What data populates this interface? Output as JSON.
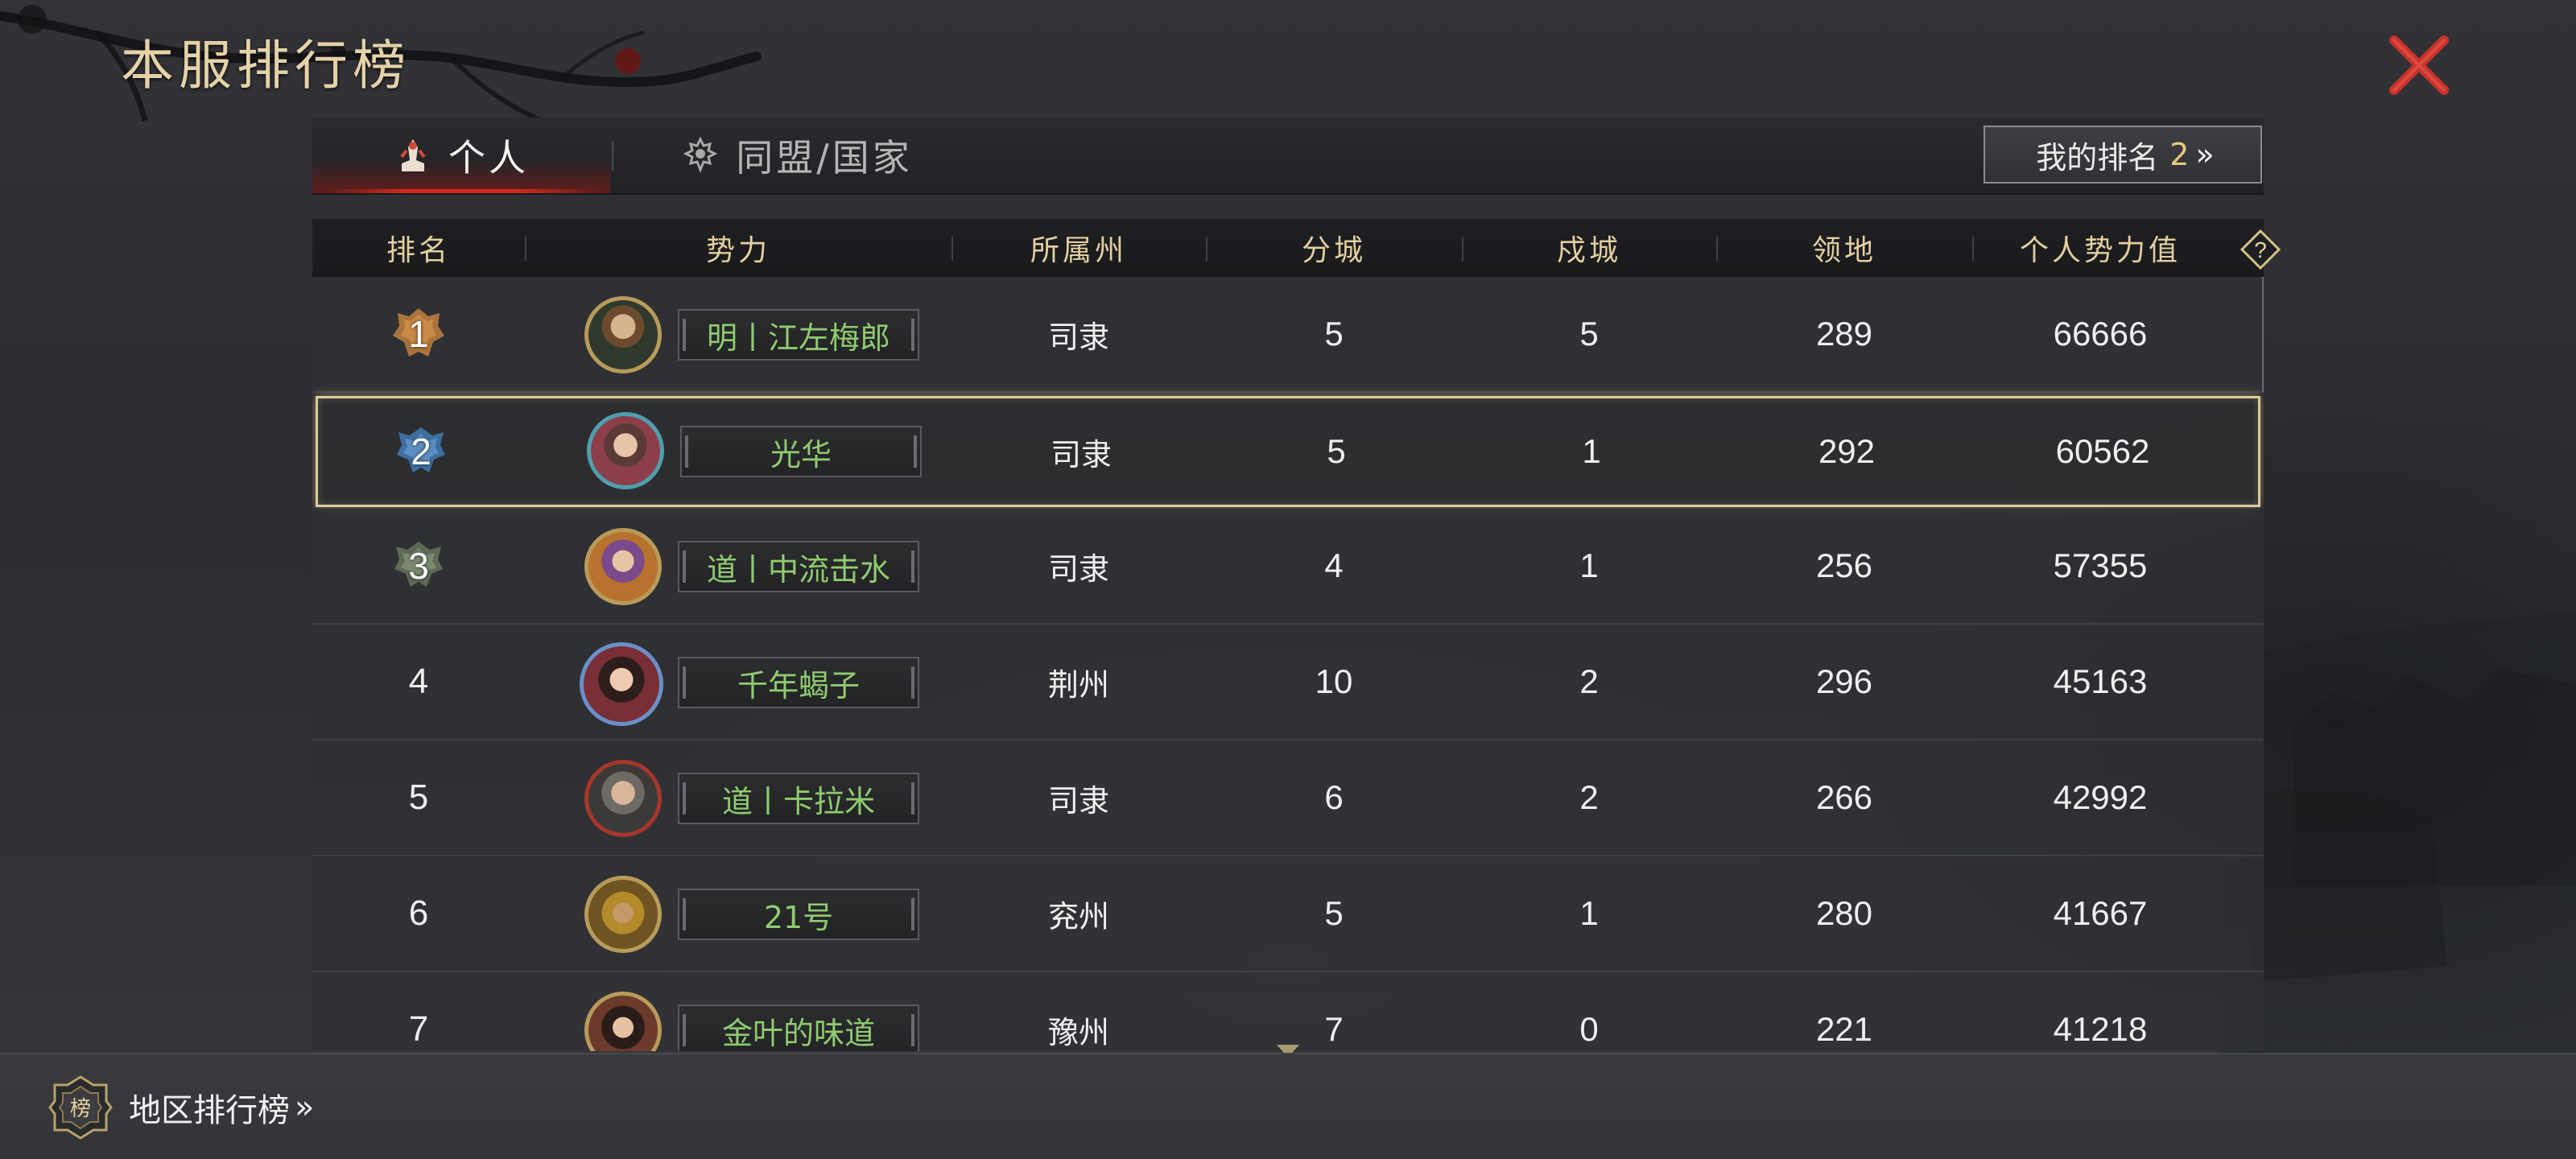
{
  "title": "本服排行榜",
  "tabs": [
    {
      "label": "个人",
      "icon": "personal-icon",
      "active": true
    },
    {
      "label": "同盟/国家",
      "icon": "alliance-icon",
      "active": false
    }
  ],
  "my_rank": {
    "label": "我的排名",
    "value": "2",
    "chevron": "»"
  },
  "columns": [
    "排名",
    "势力",
    "所属州",
    "分城",
    "戍城",
    "领地",
    "个人势力值"
  ],
  "help": {
    "label": "?"
  },
  "rows": [
    {
      "rank": "1",
      "name": "明丨江左梅郎",
      "province": "司隶",
      "branch": "5",
      "garrison": "5",
      "territory": "289",
      "power": "66666"
    },
    {
      "rank": "2",
      "name": "光华",
      "province": "司隶",
      "branch": "5",
      "garrison": "1",
      "territory": "292",
      "power": "60562"
    },
    {
      "rank": "3",
      "name": "道丨中流击水",
      "province": "司隶",
      "branch": "4",
      "garrison": "1",
      "territory": "256",
      "power": "57355"
    },
    {
      "rank": "4",
      "name": "千年蝎子",
      "province": "荆州",
      "branch": "10",
      "garrison": "2",
      "territory": "296",
      "power": "45163"
    },
    {
      "rank": "5",
      "name": "道丨卡拉米",
      "province": "司隶",
      "branch": "6",
      "garrison": "2",
      "territory": "266",
      "power": "42992"
    },
    {
      "rank": "6",
      "name": "21号",
      "province": "兖州",
      "branch": "5",
      "garrison": "1",
      "territory": "280",
      "power": "41667"
    },
    {
      "rank": "7",
      "name": "金叶的味道",
      "province": "豫州",
      "branch": "7",
      "garrison": "0",
      "territory": "221",
      "power": "41218"
    }
  ],
  "bottom": {
    "region_label": "地区排行榜",
    "chevron": "»",
    "badge_glyph": "榜"
  },
  "colors": {
    "accent_gold": "#e3cf9f",
    "name_green": "#8fcb6f",
    "close_red": "#c8322a",
    "tab_red": "#d42a1e",
    "selected_border": "#d9cf9a"
  }
}
